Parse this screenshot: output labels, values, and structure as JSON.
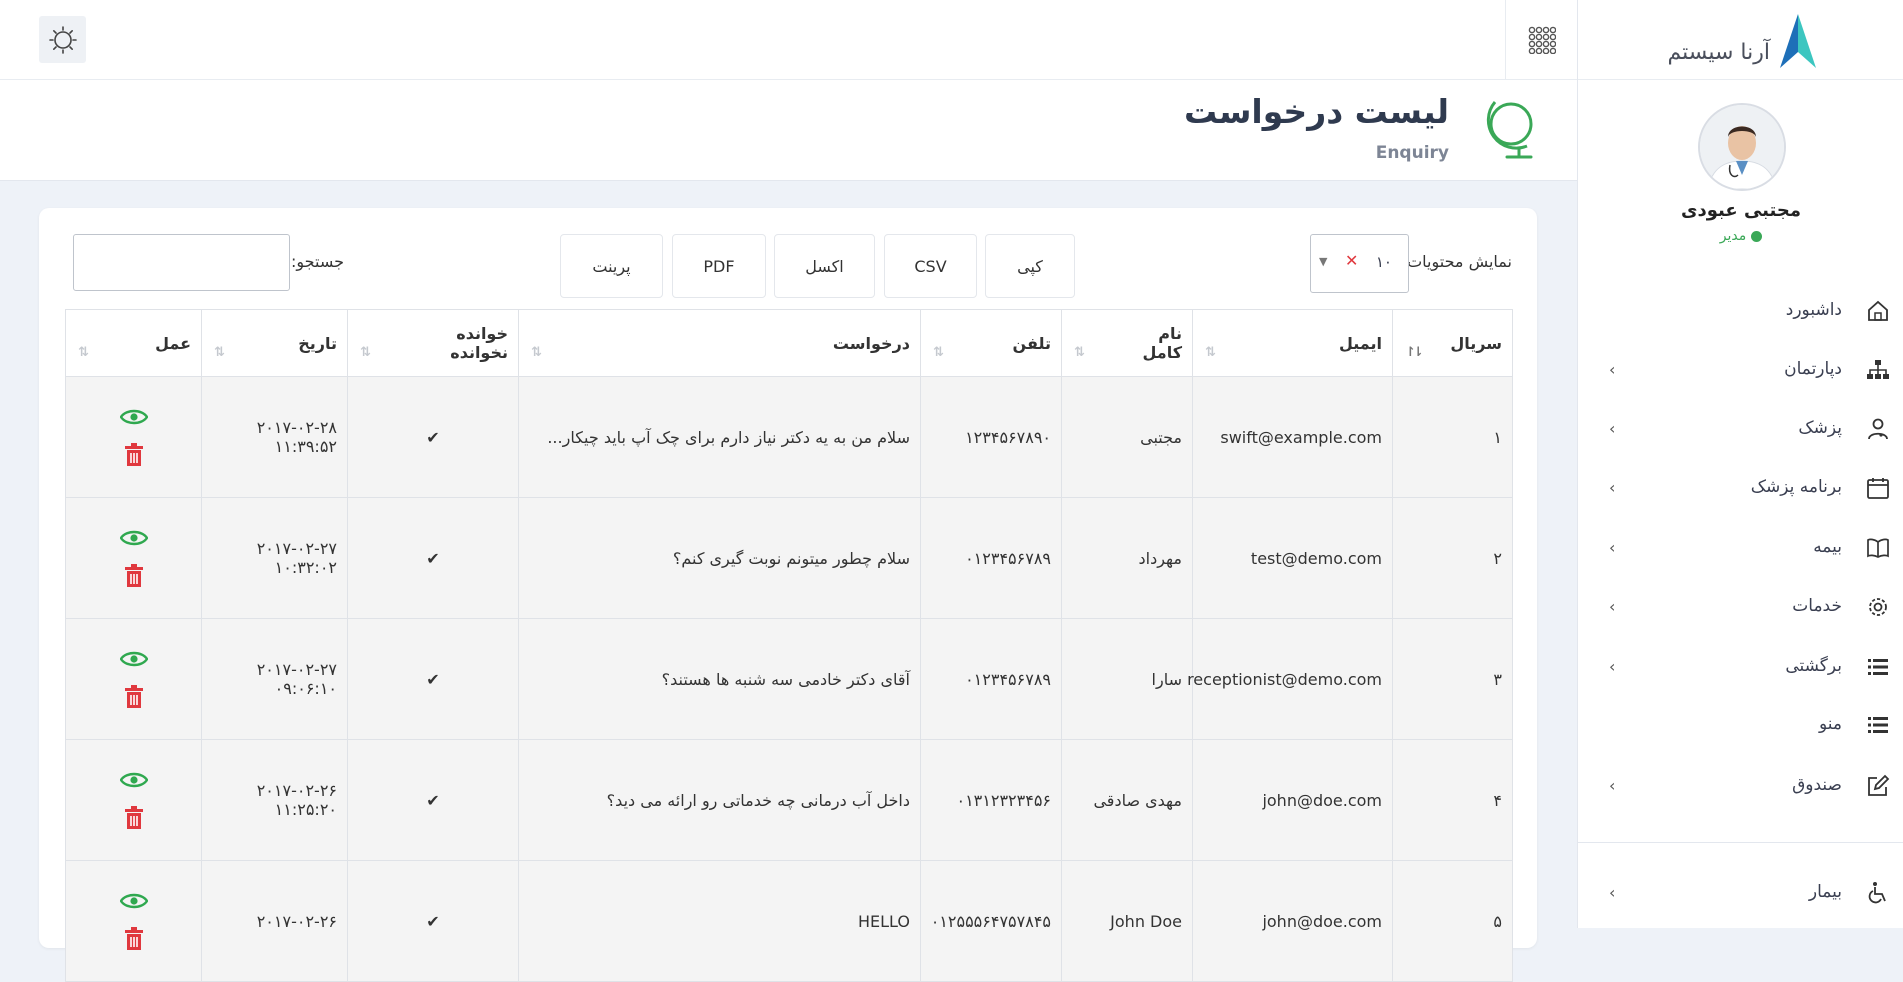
{
  "brand": {
    "name": "آرنا سیستم"
  },
  "user": {
    "name": "مجتبی عبودی",
    "role": "مدیر"
  },
  "sidebar": {
    "items": [
      {
        "label": "داشبورد",
        "icon": "home-icon",
        "has_submenu": false
      },
      {
        "label": "دپارتمان",
        "icon": "sitemap-icon",
        "has_submenu": true
      },
      {
        "label": "پزشک",
        "icon": "doctor-icon",
        "has_submenu": true
      },
      {
        "label": "برنامه پزشک",
        "icon": "calendar-icon",
        "has_submenu": true
      },
      {
        "label": "بیمه",
        "icon": "book-icon",
        "has_submenu": true
      },
      {
        "label": "خدمات",
        "icon": "gear-icon",
        "has_submenu": true
      },
      {
        "label": "برگشتی",
        "icon": "list-icon",
        "has_submenu": true
      },
      {
        "label": "منو",
        "icon": "list-icon",
        "has_submenu": false
      },
      {
        "label": "صندوق",
        "icon": "edit-icon",
        "has_submenu": true
      },
      {
        "label": "بیمار",
        "icon": "wheelchair-icon",
        "has_submenu": true
      }
    ]
  },
  "header": {
    "title": "لیست درخواست",
    "subtitle": "Enquiry"
  },
  "controls": {
    "length_label": "نمایش محتویات",
    "length_value": "۱۰",
    "clear_symbol": "✕",
    "buttons": {
      "copy": "کپی",
      "csv": "CSV",
      "excel": "اکسل",
      "pdf": "PDF",
      "print": "پرینت"
    },
    "search_label": "جستجو:",
    "search_value": ""
  },
  "table": {
    "columns": {
      "serial": "سریال",
      "email": "ایمیل",
      "full_name_1": "نام",
      "full_name_2": "کامل",
      "phone": "تلفن",
      "request": "درخواست",
      "read_1": "خوانده",
      "read_2": "نخوانده",
      "date": "تاریخ",
      "action": "عمل"
    },
    "rows": [
      {
        "serial": "۱",
        "email": "swift@example.com",
        "name": "مجتبی",
        "phone": "۱۲۳۴۵۶۷۸۹۰",
        "request": "سلام من به یه دکتر نیاز دارم برای چک آپ باید چیکار...",
        "read": "✔",
        "date": "۲۰۱۷-۰۲-۲۸ ۱۱:۳۹:۵۲"
      },
      {
        "serial": "۲",
        "email": "test@demo.com",
        "name": "مهرداد",
        "phone": "۰۱۲۳۴۵۶۷۸۹",
        "request": "سلام چطور میتونم نوبت گیری کنم؟",
        "read": "✔",
        "date": "۲۰۱۷-۰۲-۲۷ ۱۰:۳۲:۰۲"
      },
      {
        "serial": "۳",
        "email": "receptionist@demo.com",
        "name": "سارا",
        "phone": "۰۱۲۳۴۵۶۷۸۹",
        "request": "آقای دکتر خادمی سه شنبه ها هستند؟",
        "read": "✔",
        "date": "۲۰۱۷-۰۲-۲۷ ۰۹:۰۶:۱۰"
      },
      {
        "serial": "۴",
        "email": "john@doe.com",
        "name": "مهدی صادقی",
        "phone": "۰۱۳۱۲۳۲۳۴۵۶",
        "request": "داخل آب درمانی چه خدماتی رو ارائه می دید؟",
        "read": "✔",
        "date": "۲۰۱۷-۰۲-۲۶ ۱۱:۲۵:۲۰"
      },
      {
        "serial": "۵",
        "email": "john@doe.com",
        "name": "John Doe",
        "phone": "۰۱۲۵۵۵۶۴۷۵۷۸۴۵",
        "request": "HELLO",
        "read": "✔",
        "date": "۲۰۱۷-۰۲-۲۶"
      }
    ]
  },
  "colors": {
    "accent": "#3aa857",
    "danger": "#e0383e",
    "brand_teal": "#3cc6c0",
    "brand_blue": "#1e6fb8"
  }
}
